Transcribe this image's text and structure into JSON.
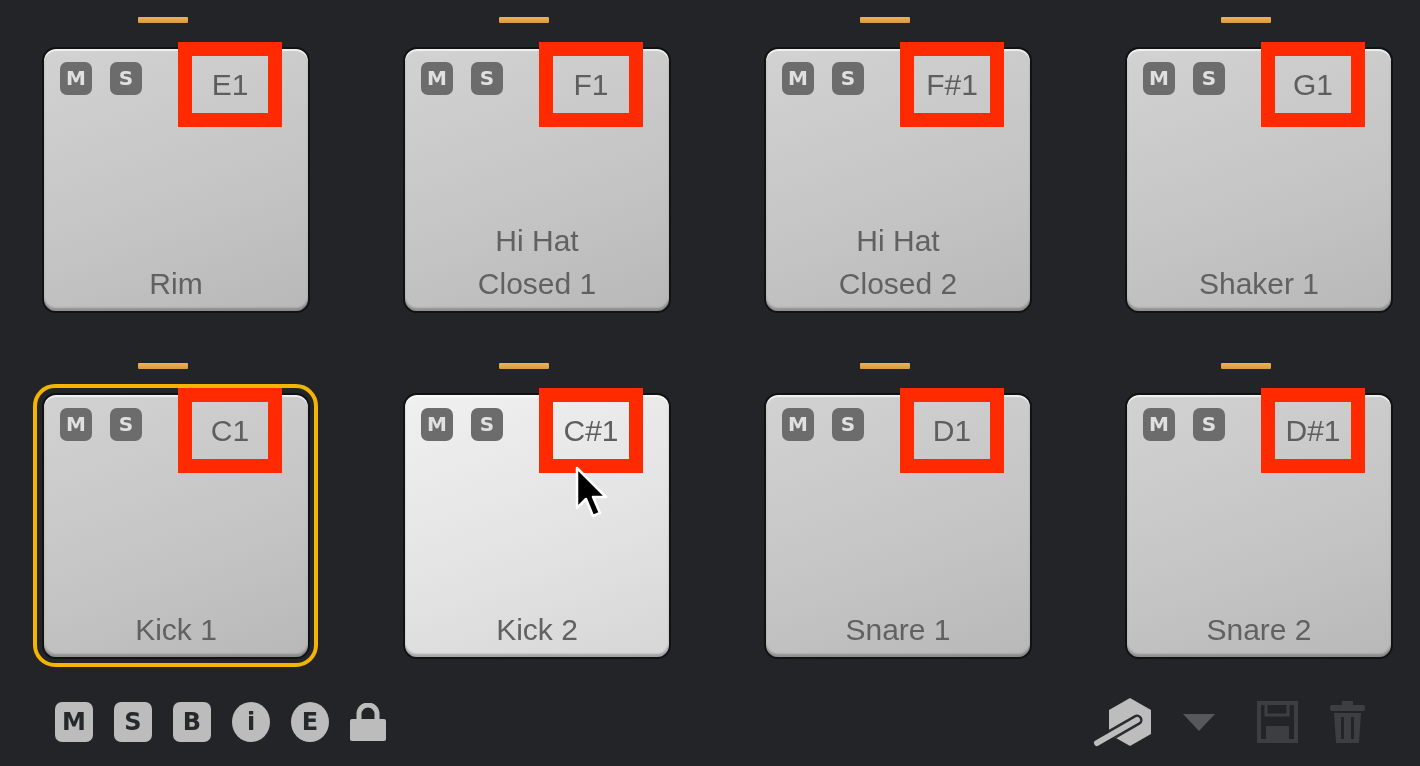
{
  "pads": [
    {
      "name": "Rim",
      "note": "E1",
      "mute_label": "M",
      "solo_label": "S",
      "selected": false,
      "hovered": false,
      "highlighted": true
    },
    {
      "name": "Hi Hat\nClosed 1",
      "note": "F1",
      "mute_label": "M",
      "solo_label": "S",
      "selected": false,
      "hovered": false,
      "highlighted": true
    },
    {
      "name": "Hi Hat\nClosed 2",
      "note": "F#1",
      "mute_label": "M",
      "solo_label": "S",
      "selected": false,
      "hovered": false,
      "highlighted": true
    },
    {
      "name": "Shaker 1",
      "note": "G1",
      "mute_label": "M",
      "solo_label": "S",
      "selected": false,
      "hovered": false,
      "highlighted": true
    },
    {
      "name": "Kick 1",
      "note": "C1",
      "mute_label": "M",
      "solo_label": "S",
      "selected": true,
      "hovered": false,
      "highlighted": true
    },
    {
      "name": "Kick 2",
      "note": "C#1",
      "mute_label": "M",
      "solo_label": "S",
      "selected": false,
      "hovered": true,
      "highlighted": true
    },
    {
      "name": "Snare 1",
      "note": "D1",
      "mute_label": "M",
      "solo_label": "S",
      "selected": false,
      "hovered": false,
      "highlighted": true
    },
    {
      "name": "Snare 2",
      "note": "D#1",
      "mute_label": "M",
      "solo_label": "S",
      "selected": false,
      "hovered": false,
      "highlighted": true
    }
  ],
  "toolbar": {
    "left": [
      {
        "kind": "square",
        "label": "M"
      },
      {
        "kind": "square",
        "label": "S"
      },
      {
        "kind": "square",
        "label": "B"
      },
      {
        "kind": "circle",
        "label": "i"
      },
      {
        "kind": "circle",
        "label": "E"
      },
      {
        "kind": "lock"
      }
    ],
    "right": [
      {
        "kind": "logo",
        "disabled": false
      },
      {
        "kind": "dropdown",
        "disabled": false
      },
      {
        "kind": "save",
        "disabled": true
      },
      {
        "kind": "trash",
        "disabled": true
      }
    ]
  }
}
